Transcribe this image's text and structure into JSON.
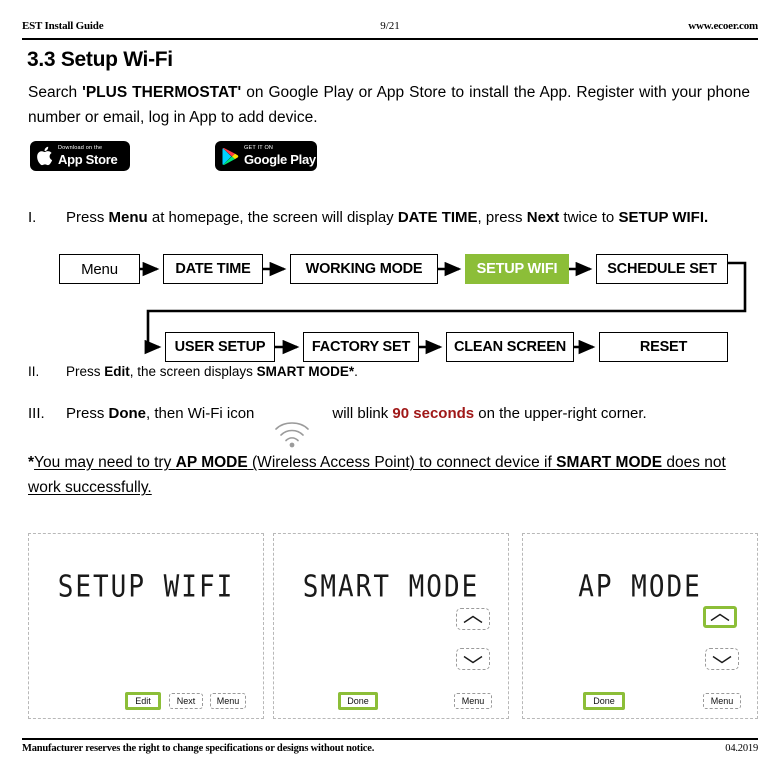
{
  "header": {
    "left": "EST Install Guide",
    "page_number": "9/21",
    "right": "www.ecoer.com"
  },
  "section": {
    "title": "3.3 Setup Wi-Fi",
    "intro_1": "Search ",
    "intro_bold": "'PLUS THERMOSTAT'",
    "intro_2": " on Google Play or App Store to install the App. Register with your phone number or email, log in App to add device."
  },
  "badges": {
    "apple": {
      "small": "Download on the",
      "big": "App Store",
      "icon": "apple-icon"
    },
    "google": {
      "small": "GET IT ON",
      "big": "Google Play",
      "icon": "google-play-icon"
    }
  },
  "steps": {
    "one": {
      "num": "I.",
      "p1": "Press ",
      "b1": "Menu",
      "p2": " at homepage, the screen will display ",
      "b2": "DATE  TIME",
      "p3": ", press ",
      "b3": "Next",
      "p4": " twice to ",
      "b4": "SETUP WIFI."
    },
    "two": {
      "num": "II.",
      "p1": "Press ",
      "b1": "Edit",
      "p2": ", the screen displays ",
      "b2": "SMART MODE*",
      "p3": "."
    },
    "three": {
      "num": "III.",
      "p1": "Press ",
      "b1": "Done",
      "p2": ", then Wi-Fi icon",
      "p3": "will blink ",
      "red": "90 seconds",
      "p4": " on the upper-right corner."
    }
  },
  "flowchart": {
    "row1": [
      {
        "label": "Menu",
        "highlight": false,
        "style": "plain"
      },
      {
        "label": "DATE TIME",
        "highlight": false,
        "style": "bold"
      },
      {
        "label": "WORKING MODE",
        "highlight": false,
        "style": "bold"
      },
      {
        "label": "SETUP WIFI",
        "highlight": true,
        "style": "bold"
      },
      {
        "label": "SCHEDULE SET",
        "highlight": false,
        "style": "bold"
      }
    ],
    "row2": [
      {
        "label": "USER SETUP",
        "highlight": false,
        "style": "bold"
      },
      {
        "label": "FACTORY SET",
        "highlight": false,
        "style": "bold"
      },
      {
        "label": "CLEAN SCREEN",
        "highlight": false,
        "style": "bold"
      },
      {
        "label": "RESET",
        "highlight": false,
        "style": "bold"
      }
    ],
    "highlight_color": "#8cbe38"
  },
  "footnote": {
    "star": "*",
    "p1": "You may need to try ",
    "b1": "AP MODE",
    "p2": " (Wireless Access Point) to connect device if ",
    "b2": "SMART MODE",
    "p3": " does not work successfully."
  },
  "screens": [
    {
      "title": "SETUP WIFI",
      "buttons": [
        {
          "label": "Edit",
          "highlight": true
        },
        {
          "label": "Next",
          "highlight": false
        },
        {
          "label": "Menu",
          "highlight": false
        }
      ],
      "arrows": []
    },
    {
      "title": "SMART MODE",
      "buttons": [
        {
          "label": "Done",
          "highlight": true
        },
        {
          "label": "Menu",
          "highlight": false
        }
      ],
      "arrows": [
        {
          "name": "chevron-up-icon",
          "highlight": false
        },
        {
          "name": "chevron-down-icon",
          "highlight": false
        }
      ]
    },
    {
      "title": "AP MODE",
      "buttons": [
        {
          "label": "Done",
          "highlight": true
        },
        {
          "label": "Menu",
          "highlight": false
        }
      ],
      "arrows": [
        {
          "name": "chevron-up-icon",
          "highlight": true
        },
        {
          "name": "chevron-down-icon",
          "highlight": false
        }
      ]
    }
  ],
  "footer": {
    "left": "Manufacturer reserves the right to change specifications or designs without notice.",
    "right": "04.2019"
  }
}
